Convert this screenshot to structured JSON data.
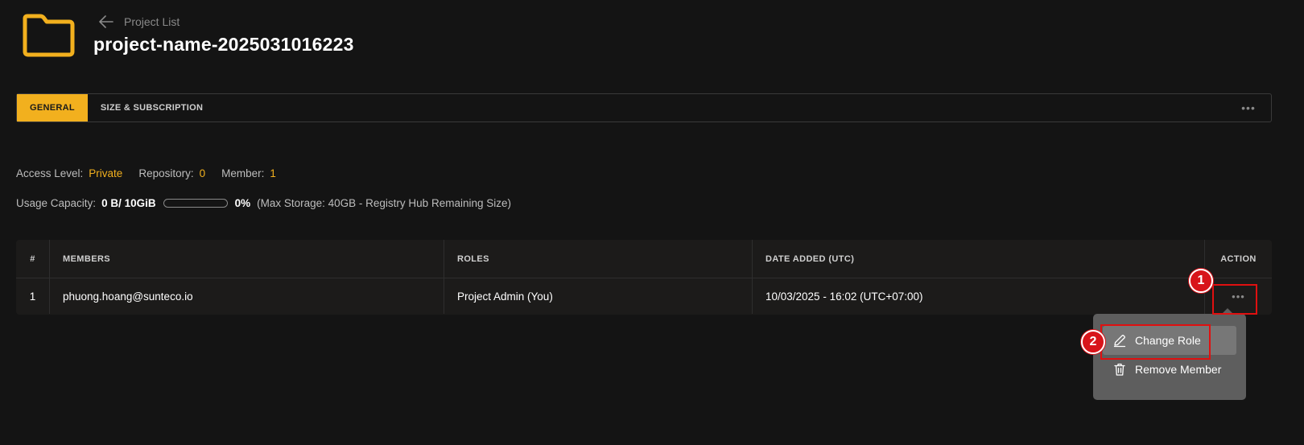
{
  "header": {
    "back_label": "Project List",
    "project_title": "project-name-2025031016223",
    "folder_color": "#f2b01e"
  },
  "tabs": [
    {
      "label": "GENERAL",
      "active": true
    },
    {
      "label": "SIZE & SUBSCRIPTION",
      "active": false
    }
  ],
  "tabs_more": "•••",
  "info": {
    "access_level_label": "Access Level:",
    "access_level_value": "Private",
    "repository_label": "Repository:",
    "repository_value": "0",
    "member_label": "Member:",
    "member_value": "1",
    "usage_label": "Usage Capacity:",
    "usage_value": "0 B/ 10GiB",
    "usage_percent": "0%",
    "usage_fraction": 0,
    "storage_note": "(Max Storage: 40GB - Registry Hub Remaining Size)"
  },
  "table": {
    "columns": [
      "#",
      "MEMBERS",
      "ROLES",
      "DATE ADDED (UTC)",
      "ACTION"
    ],
    "rows": [
      {
        "num": "1",
        "member": "phuong.hoang@sunteco.io",
        "role": "Project Admin (You)",
        "date": "10/03/2025 - 16:02 (UTC+07:00)",
        "action": "•••"
      }
    ]
  },
  "dropdown": {
    "items": [
      {
        "label": "Change Role",
        "icon": "pencil-icon"
      },
      {
        "label": "Remove Member",
        "icon": "trash-icon"
      }
    ]
  },
  "annotations": {
    "step1": "1",
    "step2": "2"
  },
  "colors": {
    "accent": "#f2b01e",
    "background": "#141414",
    "highlight": "#e01010"
  }
}
